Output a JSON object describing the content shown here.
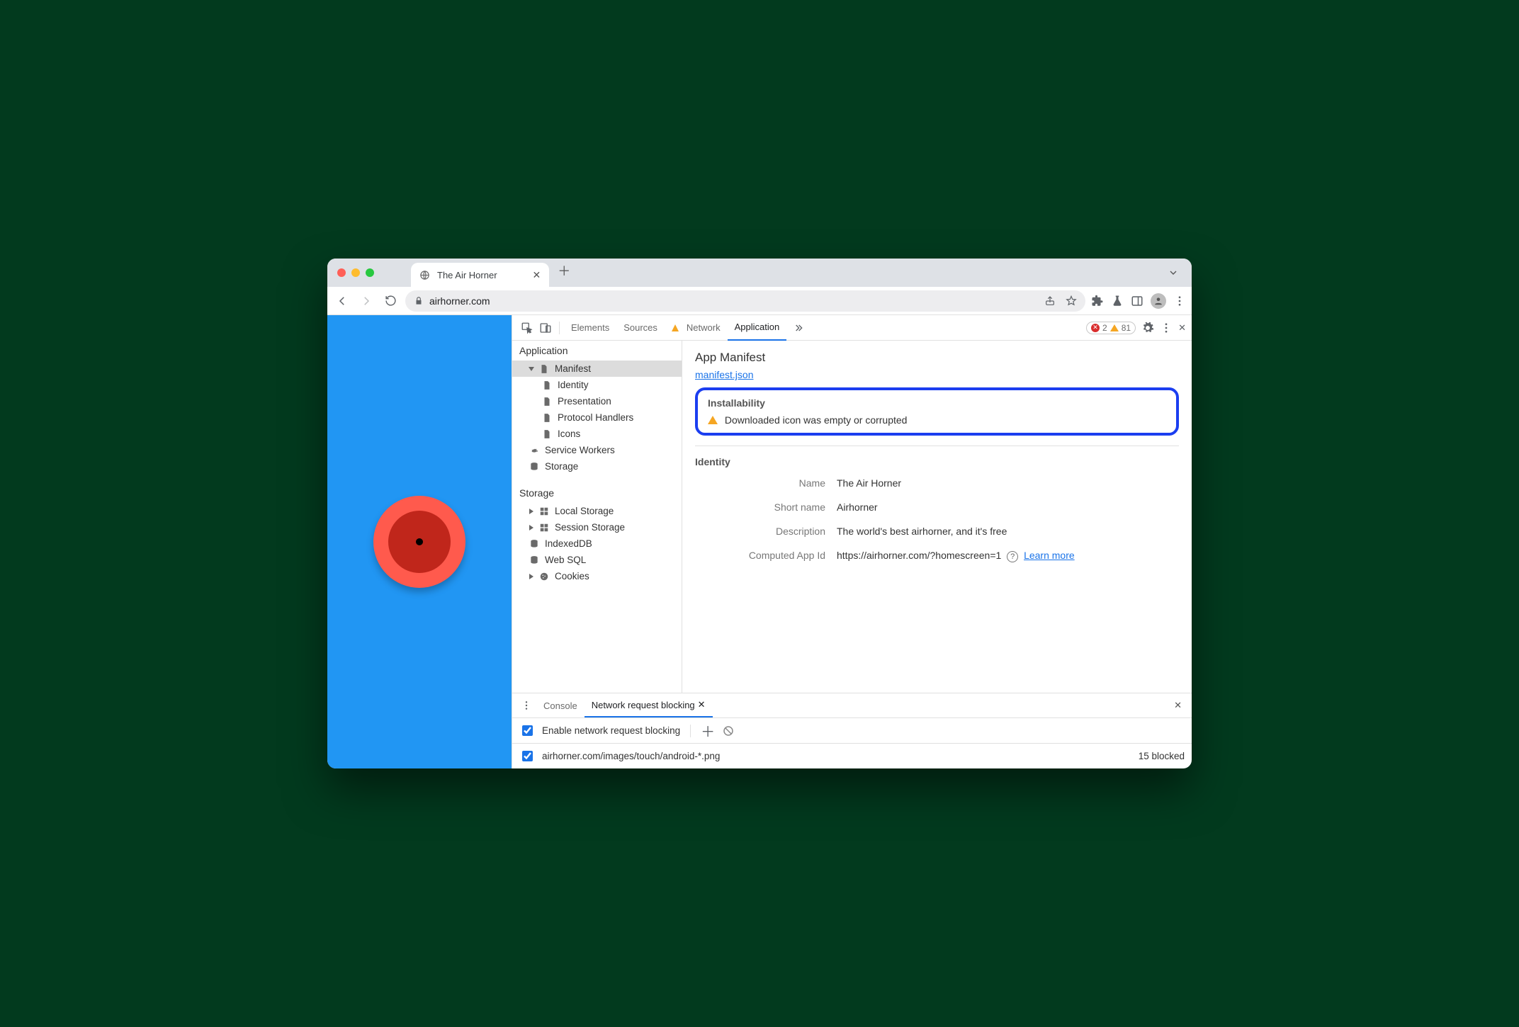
{
  "browser": {
    "tab_title": "The Air Horner",
    "url_display": "airhorner.com"
  },
  "devtools": {
    "tabs": {
      "elements": "Elements",
      "sources": "Sources",
      "network": "Network",
      "application": "Application"
    },
    "active_tab": "application",
    "error_count": "2",
    "warning_count": "81"
  },
  "sidebar": {
    "application": {
      "header": "Application",
      "manifest": "Manifest",
      "identity": "Identity",
      "presentation": "Presentation",
      "protocol_handlers": "Protocol Handlers",
      "icons": "Icons",
      "service_workers": "Service Workers",
      "storage_item": "Storage"
    },
    "storage": {
      "header": "Storage",
      "local": "Local Storage",
      "session": "Session Storage",
      "indexeddb": "IndexedDB",
      "websql": "Web SQL",
      "cookies": "Cookies"
    }
  },
  "manifest": {
    "title": "App Manifest",
    "file_link": "manifest.json",
    "installability": {
      "heading": "Installability",
      "warning": "Downloaded icon was empty or corrupted"
    },
    "identity": {
      "heading": "Identity",
      "name_label": "Name",
      "name_value": "The Air Horner",
      "short_label": "Short name",
      "short_value": "Airhorner",
      "desc_label": "Description",
      "desc_value": "The world's best airhorner, and it's free",
      "appid_label": "Computed App Id",
      "appid_value": "https://airhorner.com/?homescreen=1",
      "learn_more": "Learn more"
    }
  },
  "drawer": {
    "console_tab": "Console",
    "blocking_tab": "Network request blocking",
    "enable_label": "Enable network request blocking",
    "pattern": "airhorner.com/images/touch/android-*.png",
    "blocked_count": "15 blocked"
  }
}
